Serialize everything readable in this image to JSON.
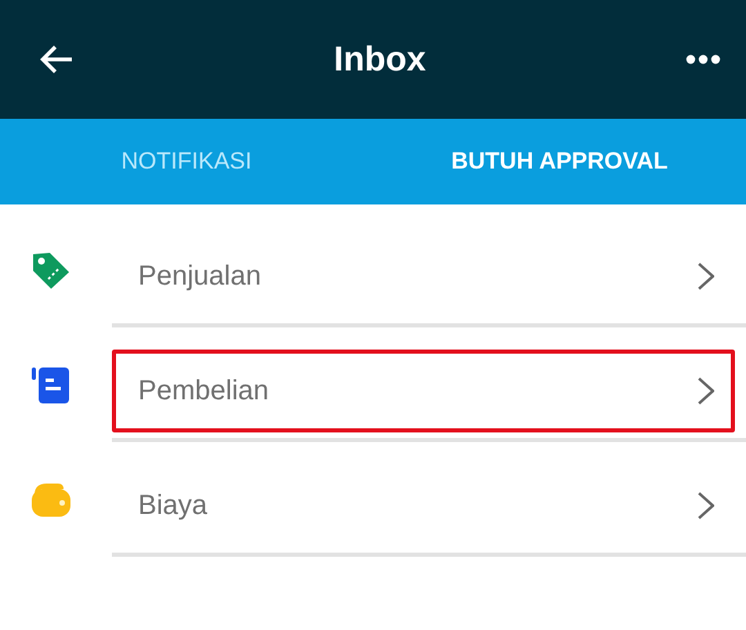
{
  "header": {
    "title": "Inbox"
  },
  "tabs": [
    {
      "label": "NOTIFIKASI",
      "selected": false
    },
    {
      "label": "BUTUH APPROVAL",
      "selected": true
    }
  ],
  "items": [
    {
      "kind": "tag",
      "label": "Penjualan",
      "highlighted": false
    },
    {
      "kind": "document",
      "label": "Pembelian",
      "highlighted": true
    },
    {
      "kind": "wallet",
      "label": "Biaya",
      "highlighted": false
    }
  ]
}
